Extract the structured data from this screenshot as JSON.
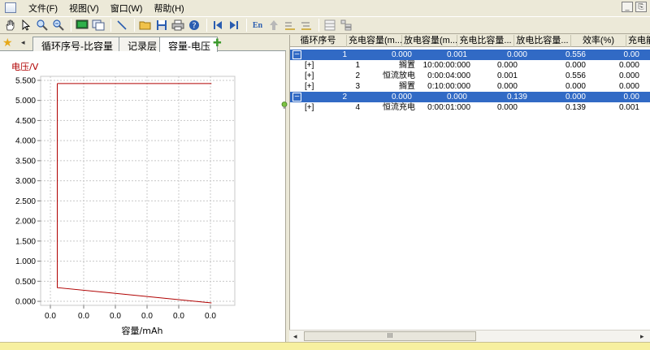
{
  "menu": {
    "items": [
      "文件(F)",
      "视图(V)",
      "窗口(W)",
      "帮助(H)"
    ],
    "window_buttons": [
      "_",
      "⎘"
    ]
  },
  "toolbar": {
    "buttons": [
      "hand-tool",
      "select-pointer",
      "zoom-in",
      "zoom-out",
      "display-green",
      "display-list",
      "line-tool",
      "open-folder",
      "save",
      "print",
      "help",
      "previous",
      "next",
      "En",
      "up-arrow",
      "cell-format-1",
      "cell-format-2",
      "grid-view",
      "tree-view"
    ],
    "en_label": "En"
  },
  "tabs": {
    "items": [
      "循环序号-比容量",
      "记录层",
      "容量-电压"
    ],
    "active_index": 2
  },
  "chart_data": {
    "type": "line",
    "title": "",
    "ylabel": "电压/V",
    "xlabel": "容量/mAh",
    "ylim": [
      -0.1,
      5.6
    ],
    "yticks": [
      "5.500",
      "5.000",
      "4.500",
      "4.000",
      "3.500",
      "3.000",
      "2.500",
      "2.000",
      "1.500",
      "1.000",
      "0.500",
      "0.000"
    ],
    "xticks": [
      "0.0",
      "0.0",
      "0.0",
      "0.0",
      "0.0",
      "0.0"
    ],
    "series": [
      {
        "color": "#b00000",
        "x": [
          0.0,
          0.0,
          0.139
        ],
        "y": [
          5.42,
          0.34,
          -0.04
        ]
      },
      {
        "color": "#b00000",
        "x": [
          0.0,
          0.139
        ],
        "y": [
          5.42,
          5.42
        ]
      }
    ],
    "grid": true
  },
  "table": {
    "headers": [
      "循环序号",
      "充电容量(m...",
      "放电容量(m...",
      "充电比容量...",
      "放电比容量...",
      "效率(%)",
      "充电能"
    ],
    "rows": [
      {
        "type": "group",
        "selected": true,
        "cells": [
          "1",
          "0.000",
          "0.001",
          "0.000",
          "0.556",
          "0.00"
        ]
      },
      {
        "type": "step",
        "cells": [
          "[+]",
          "1",
          "搁置",
          "10:00:00:000",
          "0.000",
          "0.000",
          "0.000"
        ]
      },
      {
        "type": "step",
        "cells": [
          "[+]",
          "2",
          "恒流放电",
          "0:00:04:000",
          "0.001",
          "0.556",
          "0.000"
        ]
      },
      {
        "type": "step",
        "cells": [
          "[+]",
          "3",
          "搁置",
          "0:10:00:000",
          "0.000",
          "0.000",
          "0.000"
        ]
      },
      {
        "type": "group",
        "selected": true,
        "cells": [
          "2",
          "0.000",
          "0.000",
          "0.139",
          "0.000",
          "0.00"
        ]
      },
      {
        "type": "step",
        "cells": [
          "[+]",
          "4",
          "恒流充电",
          "0:00:01:000",
          "0.000",
          "0.139",
          "0.001"
        ]
      }
    ]
  },
  "scrollbar": {
    "thumb_label": "III"
  }
}
